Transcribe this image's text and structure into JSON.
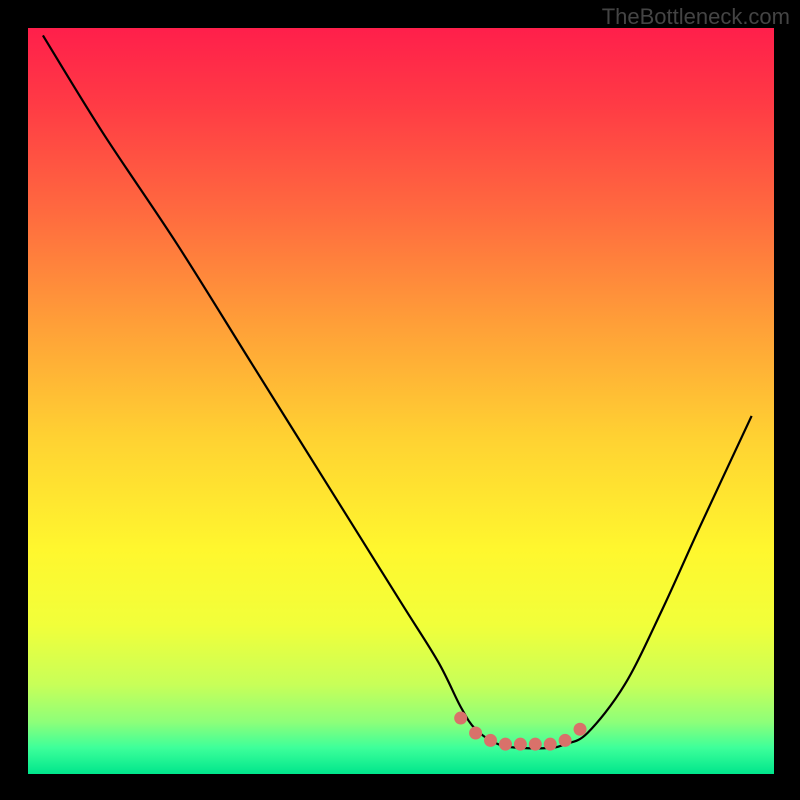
{
  "watermark": "TheBottleneck.com",
  "chart_data": {
    "type": "line",
    "title": "",
    "xlabel": "",
    "ylabel": "",
    "xlim": [
      0,
      100
    ],
    "ylim": [
      0,
      100
    ],
    "series": [
      {
        "name": "curve",
        "x": [
          2,
          10,
          20,
          30,
          40,
          50,
          55,
          58,
          60,
          63,
          66,
          70,
          72,
          75,
          80,
          85,
          90,
          97
        ],
        "y": [
          99,
          86,
          71,
          55,
          39,
          23,
          15,
          9,
          6,
          4,
          3.5,
          3.5,
          4,
          5.5,
          12,
          22,
          33,
          48
        ]
      }
    ],
    "markers": {
      "x": [
        58,
        60,
        62,
        64,
        66,
        68,
        70,
        72,
        74
      ],
      "y": [
        7.5,
        5.5,
        4.5,
        4,
        4,
        4,
        4,
        4.5,
        6
      ],
      "color": "#d9716a"
    },
    "gradient_stops": [
      {
        "offset": 0.0,
        "color": "#ff1f4b"
      },
      {
        "offset": 0.1,
        "color": "#ff3a45"
      },
      {
        "offset": 0.25,
        "color": "#ff6b3f"
      },
      {
        "offset": 0.4,
        "color": "#ffa038"
      },
      {
        "offset": 0.55,
        "color": "#ffd232"
      },
      {
        "offset": 0.7,
        "color": "#fff72e"
      },
      {
        "offset": 0.8,
        "color": "#f1ff3a"
      },
      {
        "offset": 0.88,
        "color": "#c8ff58"
      },
      {
        "offset": 0.93,
        "color": "#8eff79"
      },
      {
        "offset": 0.965,
        "color": "#3dff9a"
      },
      {
        "offset": 1.0,
        "color": "#00e68c"
      }
    ]
  }
}
